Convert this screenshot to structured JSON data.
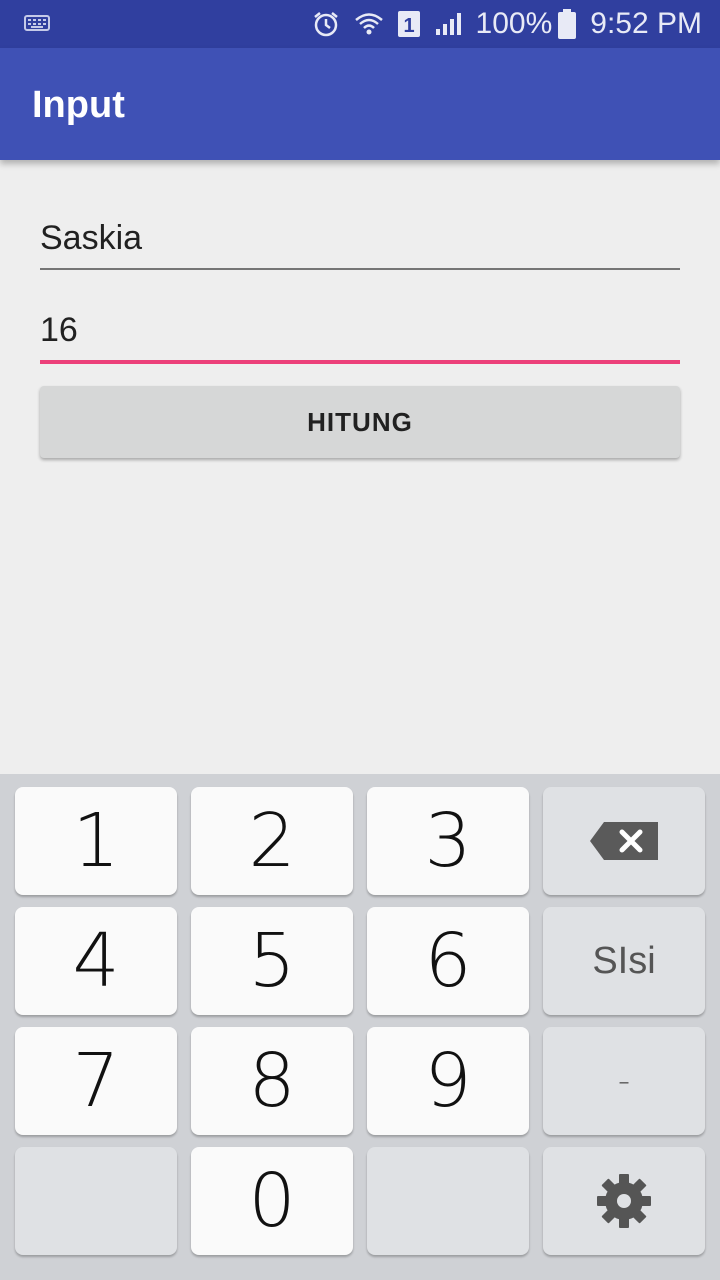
{
  "status_bar": {
    "battery": "100%",
    "time": "9:52 PM",
    "sim": "1",
    "icons": [
      "keyboard-icon",
      "alarm-icon",
      "wifi-icon",
      "sim-icon",
      "signal-icon",
      "battery-icon"
    ]
  },
  "app_bar": {
    "title": "Input"
  },
  "form": {
    "name_value": "Saskia",
    "age_value": "16",
    "button_label": "HITUNG"
  },
  "keyboard": {
    "keys": [
      "1",
      "2",
      "3",
      "4",
      "5",
      "6",
      "7",
      "8",
      "9",
      "0"
    ],
    "siisi_label": "SIsi",
    "dash_label": "-",
    "icons": [
      "backspace-icon",
      "settings-gear-icon"
    ]
  },
  "colors": {
    "status_bar": "#303f9f",
    "app_bar": "#3f51b5",
    "accent": "#ec407a"
  }
}
